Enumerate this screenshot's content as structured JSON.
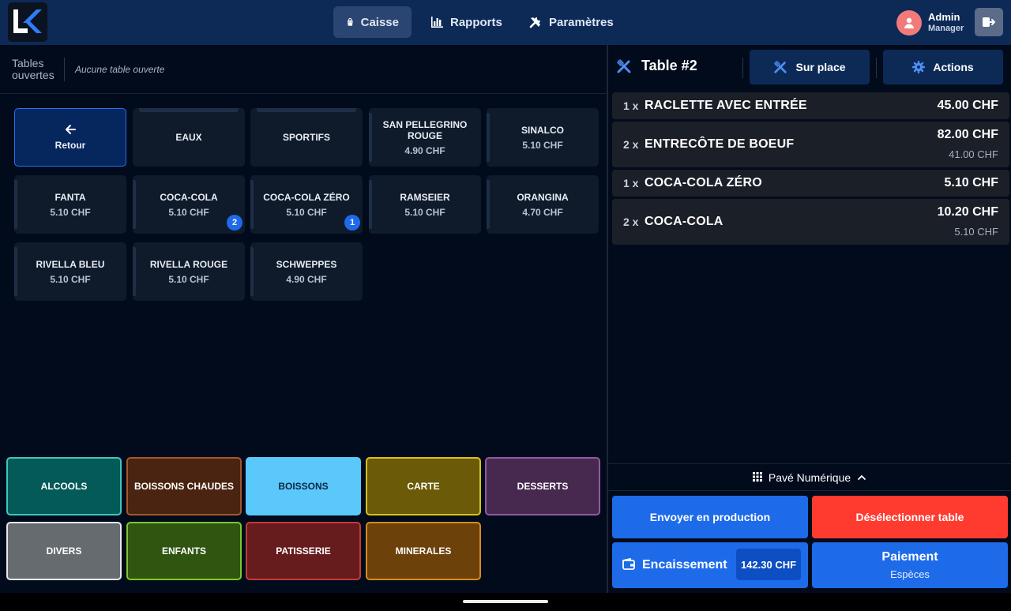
{
  "nav": {
    "items": [
      {
        "label": "Caisse",
        "icon": "shopping-bag-icon",
        "active": true
      },
      {
        "label": "Rapports",
        "icon": "bar-chart-icon",
        "active": false
      },
      {
        "label": "Paramètres",
        "icon": "tools-icon",
        "active": false
      }
    ]
  },
  "user": {
    "name": "Admin",
    "role": "Manager"
  },
  "tables": {
    "label": "Tables ouvertes",
    "empty_text": "Aucune table ouverte"
  },
  "products": [
    {
      "name": "Retour",
      "type": "back"
    },
    {
      "name": "EAUX",
      "type": "folder"
    },
    {
      "name": "SPORTIFS",
      "type": "folder"
    },
    {
      "name": "SAN PELLEGRINO ROUGE",
      "price": "4.90 CHF"
    },
    {
      "name": "SINALCO",
      "price": "5.10 CHF"
    },
    {
      "name": "FANTA",
      "price": "5.10 CHF"
    },
    {
      "name": "COCA-COLA",
      "price": "5.10 CHF",
      "badge": "2"
    },
    {
      "name": "COCA-COLA ZÉRO",
      "price": "5.10 CHF",
      "badge": "1"
    },
    {
      "name": "RAMSEIER",
      "price": "5.10 CHF"
    },
    {
      "name": "ORANGINA",
      "price": "4.70 CHF"
    },
    {
      "name": "RIVELLA BLEU",
      "price": "5.10 CHF"
    },
    {
      "name": "RIVELLA ROUGE",
      "price": "5.10 CHF"
    },
    {
      "name": "SCHWEPPES",
      "price": "4.90 CHF"
    }
  ],
  "categories": [
    {
      "label": "ALCOOLS",
      "bg": "#045a57",
      "border": "#3ec7bf",
      "text": "#ffffff"
    },
    {
      "label": "BOISSONS CHAUDES",
      "bg": "#4a2410",
      "border": "#a3582a",
      "text": "#ffffff"
    },
    {
      "label": "BOISSONS",
      "bg": "#5ac8fa",
      "border": "#5ac8fa",
      "text": "#0a2540"
    },
    {
      "label": "CARTE",
      "bg": "#6b5a08",
      "border": "#d9c21a",
      "text": "#ffffff"
    },
    {
      "label": "DESSERTS",
      "bg": "#47294f",
      "border": "#8e5aa0",
      "text": "#ffffff"
    },
    {
      "label": "DIVERS",
      "bg": "#666b70",
      "border": "#e6e8ea",
      "text": "#ffffff"
    },
    {
      "label": "ENFANTS",
      "bg": "#2f5511",
      "border": "#7cc92c",
      "text": "#ffffff"
    },
    {
      "label": "PATISSERIE",
      "bg": "#661c1c",
      "border": "#c33a3a",
      "text": "#ffffff"
    },
    {
      "label": "MINERALES",
      "bg": "#6c410a",
      "border": "#d68b1e",
      "text": "#ffffff"
    }
  ],
  "order": {
    "title": "Table #2",
    "mode_label": "Sur place",
    "actions_label": "Actions",
    "lines": [
      {
        "qty": "1 x",
        "name": "RACLETTE AVEC ENTRÉE",
        "total": "45.00 CHF",
        "unit": ""
      },
      {
        "qty": "2 x",
        "name": "ENTRECÔTE DE BOEUF",
        "total": "82.00 CHF",
        "unit": "41.00 CHF"
      },
      {
        "qty": "1 x",
        "name": "COCA-COLA ZÉRO",
        "total": "5.10 CHF",
        "unit": ""
      },
      {
        "qty": "2 x",
        "name": "COCA-COLA",
        "total": "10.20 CHF",
        "unit": "5.10 CHF"
      }
    ]
  },
  "keypad_label": "Pavé Numérique",
  "buttons": {
    "send": "Envoyer en production",
    "deselect": "Désélectionner table",
    "encaissement": "Encaissement",
    "amount": "142.30 CHF",
    "payment": "Paiement",
    "payment_method": "Espèces"
  },
  "colors": {
    "topbar": "#0d2a57",
    "accent_blue": "#1e6bea",
    "danger_red": "#ff3b30",
    "panel_bg": "#020b1c"
  }
}
